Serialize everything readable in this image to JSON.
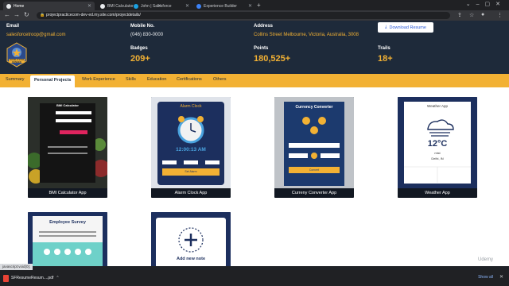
{
  "browser": {
    "tabs": [
      {
        "label": "Home",
        "active": true
      },
      {
        "label": "BMI Calculator",
        "active": false
      },
      {
        "label": "John | Salesforce",
        "active": false
      },
      {
        "label": "Experience Builder",
        "active": false
      }
    ],
    "url": "projectpracticecom-dev-ed.my.site.com/projectdetails/"
  },
  "header": {
    "email_label": "Email",
    "email_value": "salesforcetroop@gmail.com",
    "mobile_label": "Mobile No.",
    "mobile_value": "(046) 830-0000",
    "address_label": "Address",
    "address_value": "Collins Street Melbourne, Victoria, Australia, 3008",
    "download_label": "Download Resume",
    "badges_label": "Badges",
    "badges_value": "209+",
    "points_label": "Points",
    "points_value": "180,525+",
    "trails_label": "Trails",
    "trails_value": "18+",
    "logo_text": "DOUBLE STAR RANGER"
  },
  "nav": {
    "tabs": [
      "Summary",
      "Personal Projects",
      "Work Experience",
      "Skills",
      "Education",
      "Certifications",
      "Others"
    ],
    "active_index": 1
  },
  "projects": [
    {
      "caption": "BMI Calculator App",
      "thumb_title": "BMI Calculator"
    },
    {
      "caption": "Alarm Clock App",
      "thumb_title": "Alarm Clock",
      "thumb_time": "12:00:13 AM",
      "thumb_btn": "Set Alarm"
    },
    {
      "caption": "Curreny Converter App",
      "thumb_title": "Currency Converter",
      "thumb_btn": "Convert"
    },
    {
      "caption": "Weather App",
      "thumb_title": "Weather App",
      "thumb_temp": "12°C",
      "thumb_cond": "mist",
      "thumb_loc": "Delhi, IN"
    },
    {
      "caption": "",
      "thumb_title": "Employee Survey"
    },
    {
      "caption": "",
      "thumb_title": "Add new note"
    }
  ],
  "status_url": "javascript:void(0);",
  "download": {
    "file": "SFResumeResum....pdf",
    "show_all": "Show all"
  },
  "watermark": "Udemy",
  "colors": {
    "header_bg": "#1e2a3a",
    "accent": "#f2b134",
    "tab_bar": "#f2b134"
  }
}
